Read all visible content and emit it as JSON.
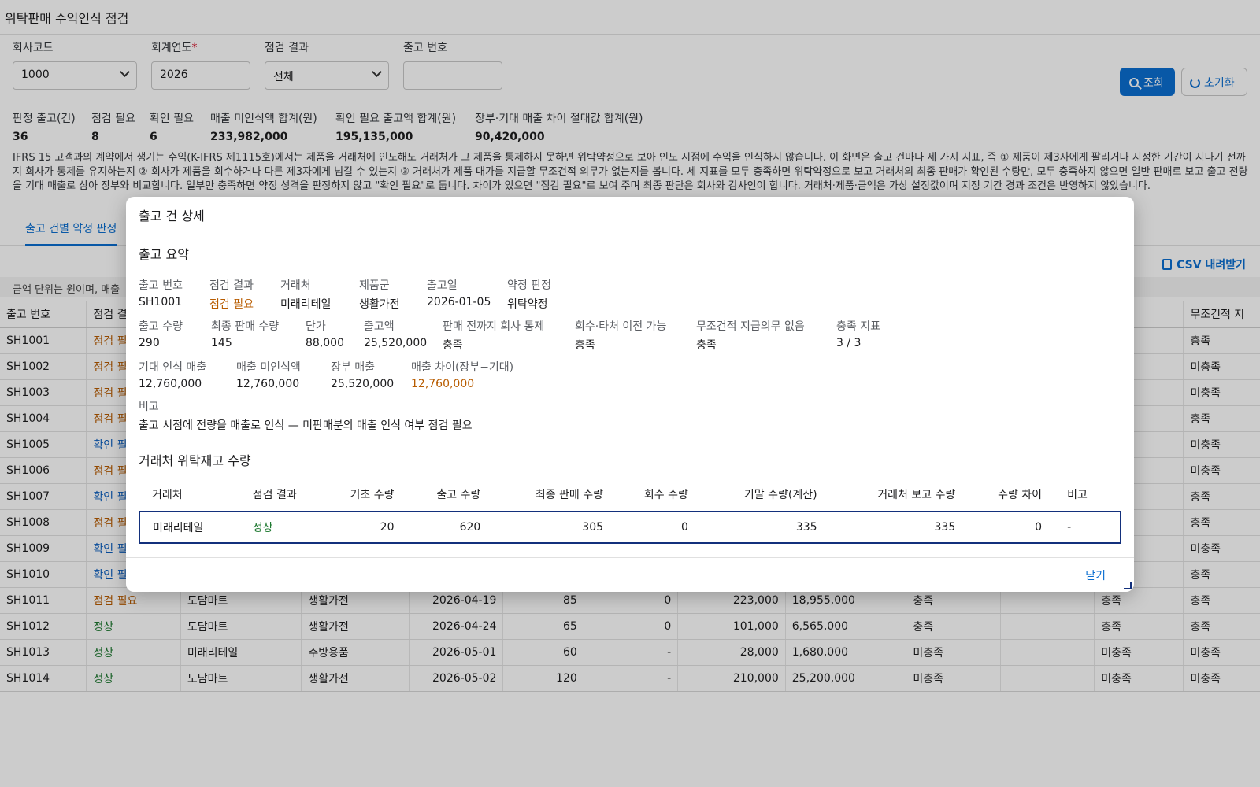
{
  "app_title": "위탁판매 수익인식 점검",
  "filters": {
    "company": {
      "label": "회사코드",
      "value": "1000"
    },
    "year": {
      "label": "회계연도",
      "required_mark": "*",
      "value": "2026"
    },
    "result": {
      "label": "점검 결과",
      "value": "전체"
    },
    "shipment": {
      "label": "출고 번호",
      "value": ""
    }
  },
  "buttons": {
    "search": "조회",
    "reset": "초기화"
  },
  "summary": [
    {
      "label": "판정 출고(건)",
      "value": "36"
    },
    {
      "label": "점검 필요",
      "value": "8"
    },
    {
      "label": "확인 필요",
      "value": "6"
    },
    {
      "label": "매출 미인식액 합계(원)",
      "value": "233,982,000"
    },
    {
      "label": "확인 필요 출고액 합계(원)",
      "value": "195,135,000"
    },
    {
      "label": "장부·기대 매출 차이 절대값 합계(원)",
      "value": "90,420,000"
    }
  ],
  "description": "IFRS 15 고객과의 계약에서 생기는 수익(K-IFRS 제1115호)에서는 제품을 거래처에 인도해도 거래처가 그 제품을 통제하지 못하면 위탁약정으로 보아 인도 시점에 수익을 인식하지 않습니다. 이 화면은 출고 건마다 세 가지 지표, 즉 ① 제품이 제3자에게 팔리거나 지정한 기간이 지나기 전까지 회사가 통제를 유지하는지 ② 회사가 제품을 회수하거나 다른 제3자에게 넘길 수 있는지 ③ 거래처가 제품 대가를 지급할 무조건적 의무가 없는지를 봅니다. 세 지표를 모두 충족하면 위탁약정으로 보고 거래처의 최종 판매가 확인된 수량만, 모두 충족하지 않으면 일반 판매로 보고 출고 전량을 기대 매출로 삼아 장부와 비교합니다. 일부만 충족하면 약정 성격을 판정하지 않고 \"확인 필요\"로 둡니다. 차이가 있으면 \"점검 필요\"로 보여 주며 최종 판단은 회사와 감사인이 합니다. 거래처·제품·금액은 가상 설정값이며 지정 기간 경과 조건은 반영하지 않았습니다.",
  "tab_active": "출고 건별 약정 판정",
  "csv_label": "CSV 내려받기",
  "unit_note": "금액 단위는 원이며, 매출",
  "table": {
    "headers": [
      "출고 번호",
      "점검 결과",
      "",
      "",
      "",
      "",
      "",
      "",
      "",
      "",
      "",
      "",
      "무조건적 지"
    ],
    "rows": [
      {
        "id": "SH1001",
        "status": "점검 필요",
        "cls": "st-check",
        "c": [
          "",
          "",
          "",
          "",
          "",
          "",
          "",
          "",
          "",
          "",
          "충족"
        ]
      },
      {
        "id": "SH1002",
        "status": "점검 필요",
        "cls": "st-check",
        "c": [
          "",
          "",
          "",
          "",
          "",
          "",
          "",
          "",
          "",
          "",
          "미충족"
        ]
      },
      {
        "id": "SH1003",
        "status": "점검 필요",
        "cls": "st-check",
        "c": [
          "",
          "",
          "",
          "",
          "",
          "",
          "",
          "",
          "",
          "",
          "미충족"
        ]
      },
      {
        "id": "SH1004",
        "status": "점검 필요",
        "cls": "st-check",
        "c": [
          "",
          "",
          "",
          "",
          "",
          "",
          "",
          "",
          "",
          "",
          "충족"
        ]
      },
      {
        "id": "SH1005",
        "status": "확인 필요",
        "cls": "st-confirm",
        "c": [
          "",
          "",
          "",
          "",
          "",
          "",
          "",
          "",
          "",
          "",
          "미충족"
        ]
      },
      {
        "id": "SH1006",
        "status": "점검 필요",
        "cls": "st-check",
        "c": [
          "",
          "",
          "",
          "",
          "",
          "",
          "",
          "",
          "",
          "",
          "미충족"
        ]
      },
      {
        "id": "SH1007",
        "status": "확인 필요",
        "cls": "st-confirm",
        "c": [
          "",
          "",
          "",
          "",
          "",
          "",
          "",
          "",
          "",
          "",
          "충족"
        ]
      },
      {
        "id": "SH1008",
        "status": "점검 필요",
        "cls": "st-check",
        "c": [
          "",
          "",
          "",
          "",
          "",
          "",
          "",
          "",
          "",
          "",
          "충족"
        ]
      },
      {
        "id": "SH1009",
        "status": "확인 필요",
        "cls": "st-confirm",
        "c": [
          "",
          "",
          "",
          "",
          "",
          "",
          "",
          "",
          "",
          "",
          "미충족"
        ]
      },
      {
        "id": "SH1010",
        "status": "확인 필요",
        "cls": "st-confirm",
        "c": [
          "",
          "",
          "",
          "",
          "",
          "",
          "",
          "",
          "",
          "",
          "충족"
        ]
      },
      {
        "id": "SH1011",
        "status": "점검 필요",
        "cls": "st-check",
        "c": [
          "도담마트",
          "생활가전",
          "2026-04-19",
          "85",
          "0",
          "223,000",
          "18,955,000",
          "충족",
          "",
          "충족",
          "충족"
        ]
      },
      {
        "id": "SH1012",
        "status": "정상",
        "cls": "st-ok",
        "c": [
          "도담마트",
          "생활가전",
          "2026-04-24",
          "65",
          "0",
          "101,000",
          "6,565,000",
          "충족",
          "",
          "충족",
          "충족"
        ]
      },
      {
        "id": "SH1013",
        "status": "정상",
        "cls": "st-ok",
        "c": [
          "미래리테일",
          "주방용품",
          "2026-05-01",
          "60",
          "-",
          "28,000",
          "1,680,000",
          "미충족",
          "",
          "미충족",
          "미충족"
        ]
      },
      {
        "id": "SH1014",
        "status": "정상",
        "cls": "st-ok",
        "c": [
          "도담마트",
          "생활가전",
          "2026-05-02",
          "120",
          "-",
          "210,000",
          "25,200,000",
          "미충족",
          "",
          "미충족",
          "미충족"
        ]
      }
    ]
  },
  "modal": {
    "title": "출고 건 상세",
    "summary_title": "출고 요약",
    "row1": [
      {
        "k": "출고 번호",
        "v": "SH1001"
      },
      {
        "k": "점검 결과",
        "v": "점검 필요"
      },
      {
        "k": "거래처",
        "v": "미래리테일"
      },
      {
        "k": "제품군",
        "v": "생활가전"
      },
      {
        "k": "출고일",
        "v": "2026-01-05"
      },
      {
        "k": "약정 판정",
        "v": "위탁약정"
      }
    ],
    "row2": [
      {
        "k": "출고 수량",
        "v": "290"
      },
      {
        "k": "최종 판매 수량",
        "v": "145"
      },
      {
        "k": "단가",
        "v": "88,000"
      },
      {
        "k": "출고액",
        "v": "25,520,000"
      },
      {
        "k": "판매 전까지 회사 통제",
        "v": "충족"
      },
      {
        "k": "회수·타처 이전 가능",
        "v": "충족"
      },
      {
        "k": "무조건적 지급의무 없음",
        "v": "충족"
      },
      {
        "k": "충족 지표",
        "v": "3 / 3"
      }
    ],
    "row3": [
      {
        "k": "기대 인식 매출",
        "v": "12,760,000"
      },
      {
        "k": "매출 미인식액",
        "v": "12,760,000"
      },
      {
        "k": "장부 매출",
        "v": "25,520,000"
      },
      {
        "k": "매출 차이(장부−기대)",
        "v": "12,760,000"
      }
    ],
    "note_label": "비고",
    "note_value": "출고 시점에 전량을 매출로 인식 — 미판매분의 매출 인식 여부 점검 필요",
    "inv_title": "거래처 위탁재고 수량",
    "inv_headers": [
      "거래처",
      "점검 결과",
      "기초 수량",
      "출고 수량",
      "최종 판매 수량",
      "회수 수량",
      "기말 수량(계산)",
      "거래처 보고 수량",
      "수량 차이",
      "비고"
    ],
    "inv_row": [
      "미래리테일",
      "정상",
      "20",
      "620",
      "305",
      "0",
      "335",
      "335",
      "0",
      "-"
    ],
    "close": "닫기"
  }
}
